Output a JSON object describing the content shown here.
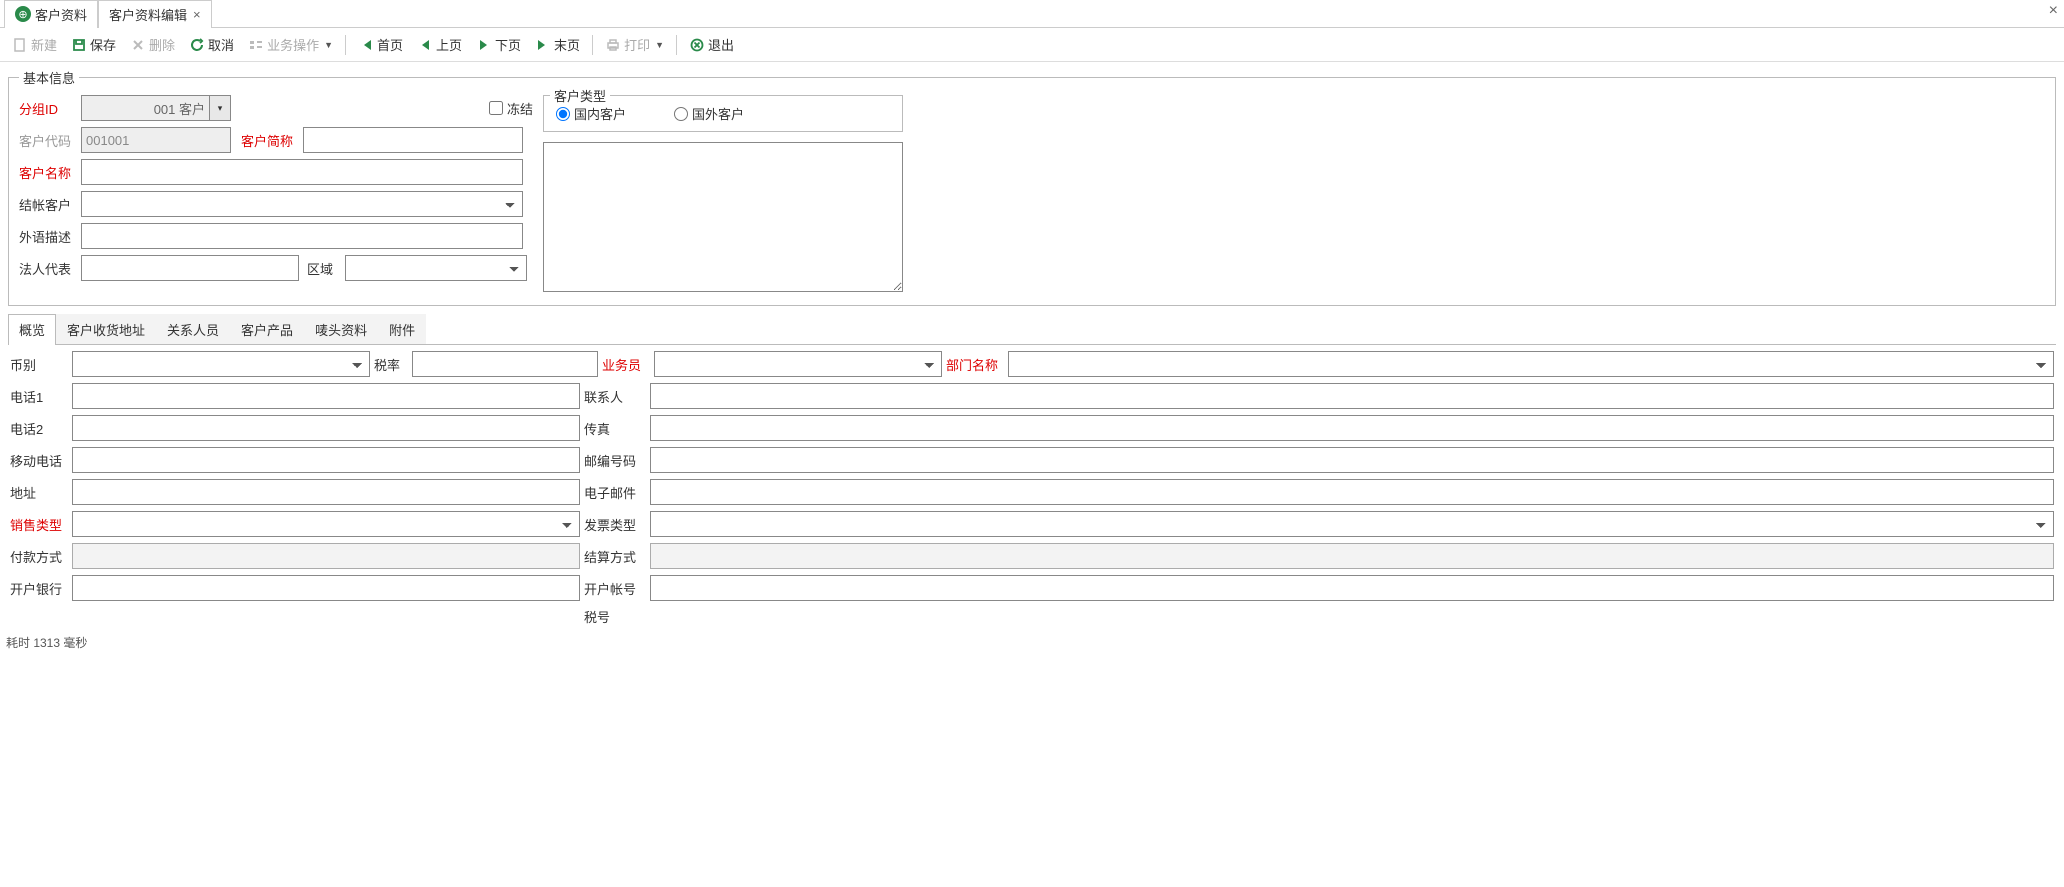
{
  "tabs": {
    "tab1": "客户资料",
    "tab2": "客户资料编辑"
  },
  "toolbar": {
    "new": "新建",
    "save": "保存",
    "delete": "删除",
    "cancel": "取消",
    "bizop": "业务操作",
    "first": "首页",
    "prev": "上页",
    "next": "下页",
    "last": "末页",
    "print": "打印",
    "exit": "退出"
  },
  "basic": {
    "legend": "基本信息",
    "groupid_label": "分组ID",
    "groupid_value": "001 客户",
    "freeze_label": "冻结",
    "custcode_label": "客户代码",
    "custcode_value": "001001",
    "shortname_label": "客户简称",
    "custname_label": "客户名称",
    "billcust_label": "结帐客户",
    "foreigndesc_label": "外语描述",
    "legalrep_label": "法人代表",
    "region_label": "区域",
    "custtype_legend": "客户类型",
    "radio_domestic": "国内客户",
    "radio_foreign": "国外客户"
  },
  "subtabs": {
    "t1": "概览",
    "t2": "客户收货地址",
    "t3": "关系人员",
    "t4": "客户产品",
    "t5": "唛头资料",
    "t6": "附件"
  },
  "ov": {
    "currency": "币别",
    "taxrate": "税率",
    "salesperson": "业务员",
    "deptname": "部门名称",
    "phone1": "电话1",
    "contact": "联系人",
    "phone2": "电话2",
    "fax": "传真",
    "mobile": "移动电话",
    "zipcode": "邮编号码",
    "address": "地址",
    "email": "电子邮件",
    "salestype": "销售类型",
    "invoicetype": "发票类型",
    "paymethod": "付款方式",
    "settlemethod": "结算方式",
    "bank": "开户银行",
    "account": "开户帐号",
    "taxno": "税号"
  },
  "footer": "耗时 1313 毫秒"
}
